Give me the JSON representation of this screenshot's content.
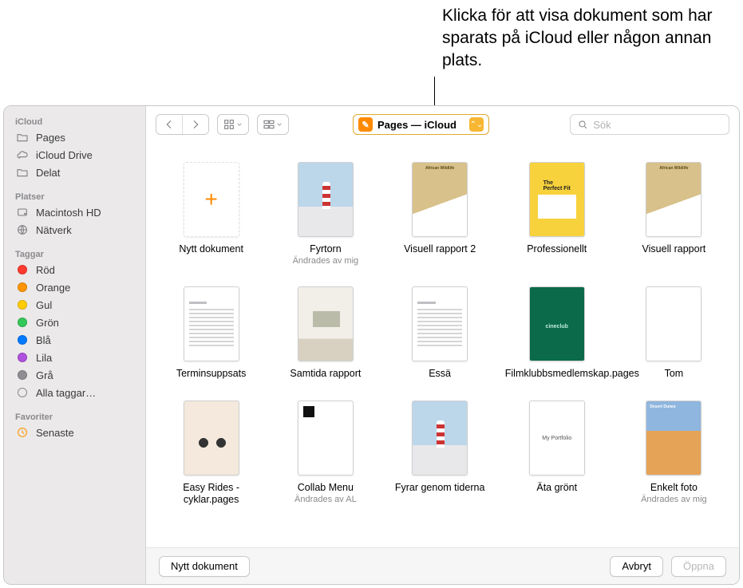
{
  "callout": "Klicka för att visa dokument som har sparats på iCloud eller någon annan plats.",
  "sidebar": {
    "sections": [
      {
        "title": "iCloud",
        "items": [
          {
            "label": "Pages",
            "glyph": "folder"
          },
          {
            "label": "iCloud Drive",
            "glyph": "cloud"
          },
          {
            "label": "Delat",
            "glyph": "shared"
          }
        ]
      },
      {
        "title": "Platser",
        "items": [
          {
            "label": "Macintosh HD",
            "glyph": "disk"
          },
          {
            "label": "Nätverk",
            "glyph": "network"
          }
        ]
      },
      {
        "title": "Taggar",
        "items": [
          {
            "label": "Röd",
            "glyph": "tag",
            "color": "#ff3b30"
          },
          {
            "label": "Orange",
            "glyph": "tag",
            "color": "#ff9500"
          },
          {
            "label": "Gul",
            "glyph": "tag",
            "color": "#ffcc00"
          },
          {
            "label": "Grön",
            "glyph": "tag",
            "color": "#34c759"
          },
          {
            "label": "Blå",
            "glyph": "tag",
            "color": "#007aff"
          },
          {
            "label": "Lila",
            "glyph": "tag",
            "color": "#af52de"
          },
          {
            "label": "Grå",
            "glyph": "tag",
            "color": "#8e8e93"
          },
          {
            "label": "Alla taggar…",
            "glyph": "alltags"
          }
        ]
      },
      {
        "title": "Favoriter",
        "items": [
          {
            "label": "Senaste",
            "glyph": "recent"
          }
        ]
      }
    ]
  },
  "toolbar": {
    "path_app": "Pages",
    "path_location": "iCloud",
    "search_placeholder": "Sök"
  },
  "files": [
    {
      "name": "Nytt dokument",
      "sub": "",
      "art": "new"
    },
    {
      "name": "Fyrtorn",
      "sub": "Ändrades av mig",
      "art": "lighthouse"
    },
    {
      "name": "Visuell rapport 2",
      "sub": "",
      "art": "wildlife"
    },
    {
      "name": "Professionellt",
      "sub": "",
      "art": "fit"
    },
    {
      "name": "Visuell rapport",
      "sub": "",
      "art": "wildlife"
    },
    {
      "name": "Terminsuppsats",
      "sub": "",
      "art": "text"
    },
    {
      "name": "Samtida rapport",
      "sub": "",
      "art": "room"
    },
    {
      "name": "Essä",
      "sub": "",
      "art": "text"
    },
    {
      "name": "Filmklubbsmedlemskap.pages",
      "sub": "",
      "art": "club"
    },
    {
      "name": "Tom",
      "sub": "",
      "art": "blank"
    },
    {
      "name": "Easy Rides -cyklar.pages",
      "sub": "",
      "art": "bike"
    },
    {
      "name": "Collab Menu",
      "sub": "Ändrades av AL",
      "art": "collab"
    },
    {
      "name": "Fyrar genom tiderna",
      "sub": "",
      "art": "lighthouse"
    },
    {
      "name": "Äta grönt",
      "sub": "",
      "art": "green"
    },
    {
      "name": "Enkelt foto",
      "sub": "Ändrades av mig",
      "art": "dunes"
    }
  ],
  "bottom": {
    "new_document": "Nytt dokument",
    "cancel": "Avbryt",
    "open": "Öppna"
  }
}
